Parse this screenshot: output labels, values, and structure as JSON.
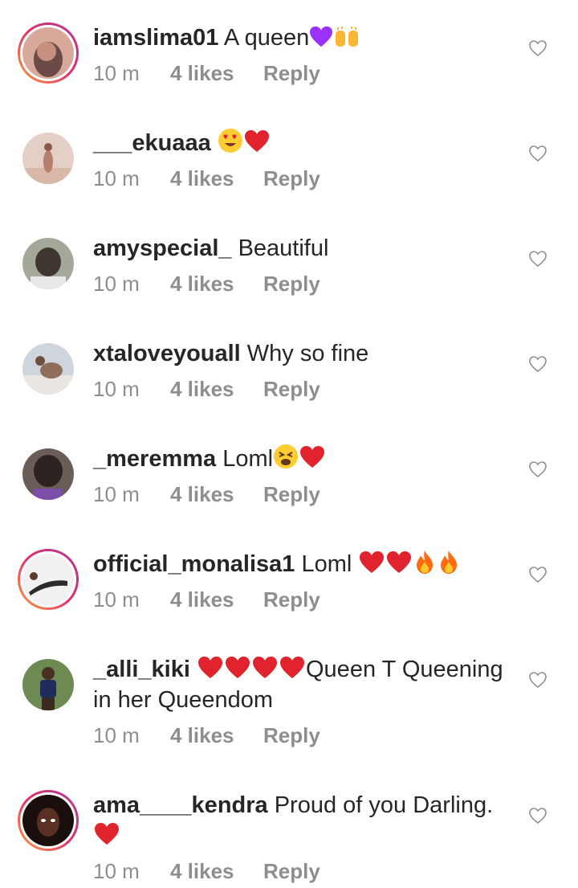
{
  "comments": [
    {
      "username": "iamslima01",
      "text": " A queen",
      "emojis": [
        "purple-heart",
        "raising-hands"
      ],
      "time": "10 m",
      "likes": "4 likes",
      "reply": "Reply",
      "story_ring": true,
      "avatar_colors": [
        "#d7a99a",
        "#6b4a48"
      ]
    },
    {
      "username": "___ekuaaa",
      "text": " ",
      "emojis": [
        "heart-eyes",
        "red-heart"
      ],
      "time": "10 m",
      "likes": "4 likes",
      "reply": "Reply",
      "story_ring": false,
      "avatar_colors": [
        "#e3cfc6",
        "#b57f6a"
      ]
    },
    {
      "username": "amyspecial_",
      "text": " Beautiful",
      "emojis": [],
      "time": "10 m",
      "likes": "4 likes",
      "reply": "Reply",
      "story_ring": false,
      "avatar_colors": [
        "#a3a89a",
        "#3f372f"
      ]
    },
    {
      "username": "xtaloveyouall",
      "text": " Why so fine",
      "emojis": [],
      "time": "10 m",
      "likes": "4 likes",
      "reply": "Reply",
      "story_ring": false,
      "avatar_colors": [
        "#cfd5dc",
        "#8f6e5c"
      ]
    },
    {
      "username": "_meremma",
      "text": " Loml",
      "emojis": [
        "tired-face",
        "red-heart"
      ],
      "time": "10 m",
      "likes": "4 likes",
      "reply": "Reply",
      "story_ring": false,
      "avatar_colors": [
        "#6a5d58",
        "#2c2220"
      ]
    },
    {
      "username": "official_monalisa1",
      "text": " Loml ",
      "emojis": [
        "red-heart",
        "red-heart",
        "fire",
        "fire"
      ],
      "time": "10 m",
      "likes": "4 likes",
      "reply": "Reply",
      "story_ring": true,
      "avatar_colors": [
        "#f1f1f1",
        "#2b2b2b"
      ]
    },
    {
      "username": "_alli_kiki",
      "text_before": " ",
      "emojis": [
        "red-heart",
        "red-heart",
        "red-heart",
        "red-heart"
      ],
      "text": "Queen T Queening in her Queendom",
      "time": "10 m",
      "likes": "4 likes",
      "reply": "Reply",
      "story_ring": false,
      "avatar_colors": [
        "#6d8a52",
        "#1e2d5c"
      ]
    },
    {
      "username": "ama____kendra",
      "text": " Proud of you Darling.",
      "emojis": [
        "red-heart"
      ],
      "time": "10 m",
      "likes": "4 likes",
      "reply": "Reply",
      "story_ring": true,
      "avatar_colors": [
        "#5a2f24",
        "#1a0f0c"
      ]
    }
  ],
  "like_icon": "heart-outline-icon",
  "colors": {
    "text": "#262626",
    "meta": "#8e8e8e",
    "heart": "#e0232c"
  }
}
